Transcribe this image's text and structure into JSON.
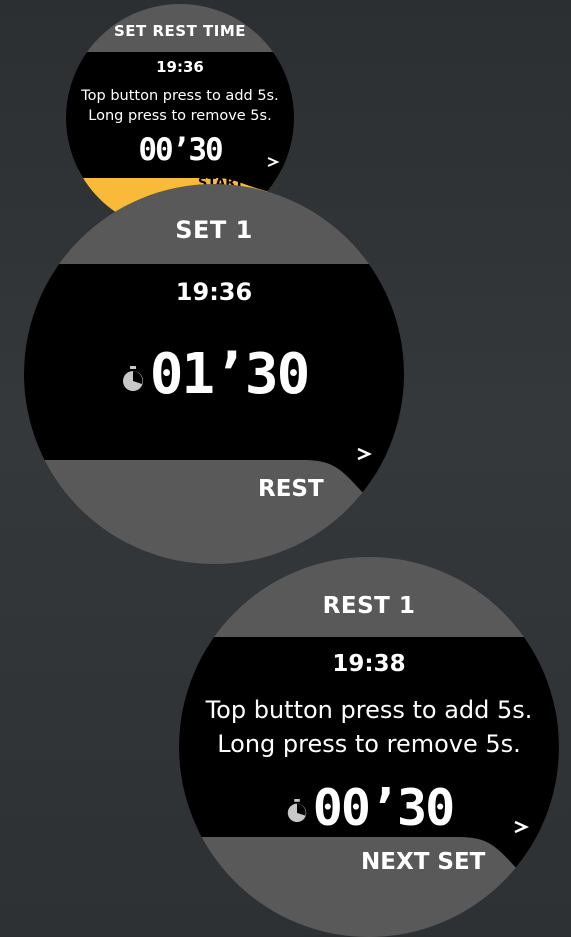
{
  "watches": [
    {
      "title": "SET REST TIME",
      "clock": "19:36",
      "hint_line_1": "Top button press to add 5s.",
      "hint_line_2": "Long press to remove 5s.",
      "timer": "00’30",
      "action_label": "START",
      "action_icon": "chevron-right-icon",
      "accent_color": "#f9b939"
    },
    {
      "title": "SET 1",
      "clock": "19:36",
      "timer": "01’30",
      "timer_icon": "stopwatch-icon",
      "action_label": "REST",
      "action_icon": "chevron-right-icon"
    },
    {
      "title": "REST 1",
      "clock": "19:38",
      "hint_line_1": "Top button press to add 5s.",
      "hint_line_2": "Long press to remove 5s.",
      "timer": "00’30",
      "timer_icon": "stopwatch-icon",
      "action_label": "NEXT SET",
      "action_icon": "chevron-right-icon"
    }
  ],
  "colors": {
    "background": "#2f3234",
    "watch_gray": "#595959",
    "screen_black": "#000000",
    "accent_yellow": "#f9b939",
    "text": "#ffffff"
  }
}
